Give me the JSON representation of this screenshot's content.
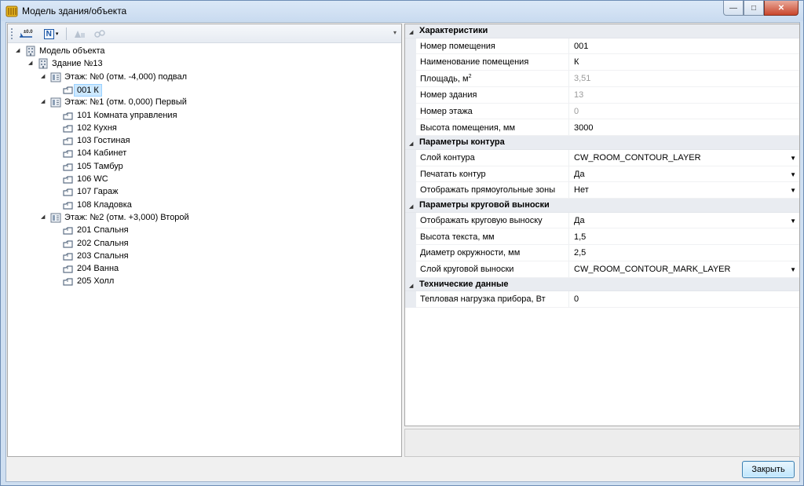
{
  "window": {
    "title": "Модель здания/объекта",
    "controls": {
      "minimize": "—",
      "maximize": "□",
      "close": "✕"
    }
  },
  "toolbar": {
    "items": [
      {
        "name": "elevation-tool",
        "label": "±0.0"
      },
      {
        "name": "numbering-tool",
        "label": "N"
      }
    ],
    "overflow": "▾"
  },
  "tree": {
    "root": {
      "label": "Модель объекта",
      "icon": "building-model-icon"
    },
    "building": {
      "label": "Здание №13",
      "icon": "building-icon"
    },
    "floors": [
      {
        "label": "Этаж: №0 (отм. -4,000) подвал",
        "rooms": [
          "001 К"
        ]
      },
      {
        "label": "Этаж: №1 (отм. 0,000) Первый",
        "rooms": [
          "101 Комната управления",
          "102 Кухня",
          "103 Гостиная",
          "104 Кабинет",
          "105 Тамбур",
          "106 WC",
          "107 Гараж",
          "108 Кладовка"
        ]
      },
      {
        "label": "Этаж: №2 (отм. +3,000) Второй",
        "rooms": [
          "201 Спальня",
          "202 Спальня",
          "203 Спальня",
          "204 Ванна",
          "205 Холл"
        ]
      }
    ],
    "selected_room": "001 К"
  },
  "properties": {
    "categories": [
      {
        "label": "Характеристики",
        "props": [
          {
            "name": "Номер помещения",
            "value": "001",
            "readonly": false,
            "dropdown": false
          },
          {
            "name": "Наименование помещения",
            "value": "К",
            "readonly": false,
            "dropdown": false
          },
          {
            "name": "Площадь, м",
            "sup": "2",
            "value": "3,51",
            "readonly": true,
            "dropdown": false
          },
          {
            "name": "Номер здания",
            "value": "13",
            "readonly": true,
            "dropdown": false
          },
          {
            "name": "Номер этажа",
            "value": "0",
            "readonly": true,
            "dropdown": false
          },
          {
            "name": "Высота помещения, мм",
            "value": "3000",
            "readonly": false,
            "dropdown": false
          }
        ]
      },
      {
        "label": "Параметры контура",
        "props": [
          {
            "name": "Слой контура",
            "value": "CW_ROOM_CONTOUR_LAYER",
            "readonly": false,
            "dropdown": true
          },
          {
            "name": "Печатать контур",
            "value": "Да",
            "readonly": false,
            "dropdown": true
          },
          {
            "name": "Отображать прямоугольные зоны",
            "value": "Нет",
            "readonly": false,
            "dropdown": true
          }
        ]
      },
      {
        "label": "Параметры круговой выноски",
        "props": [
          {
            "name": "Отображать круговую выноску",
            "value": "Да",
            "readonly": false,
            "dropdown": true
          },
          {
            "name": "Высота текста, мм",
            "value": "1,5",
            "readonly": false,
            "dropdown": false
          },
          {
            "name": "Диаметр окружности, мм",
            "value": "2,5",
            "readonly": false,
            "dropdown": false
          },
          {
            "name": "Слой круговой выноски",
            "value": "CW_ROOM_CONTOUR_MARK_LAYER",
            "readonly": false,
            "dropdown": true
          }
        ]
      },
      {
        "label": "Технические данные",
        "props": [
          {
            "name": "Тепловая нагрузка прибора, Вт",
            "value": "0",
            "readonly": false,
            "dropdown": false
          }
        ]
      }
    ]
  },
  "footer": {
    "close_label": "Закрыть"
  },
  "colors": {
    "selection": "#cce8ff",
    "category_bg": "#e9ecf1",
    "readonly_text": "#9b9b9b",
    "titlebar": "#c9dbf0"
  }
}
